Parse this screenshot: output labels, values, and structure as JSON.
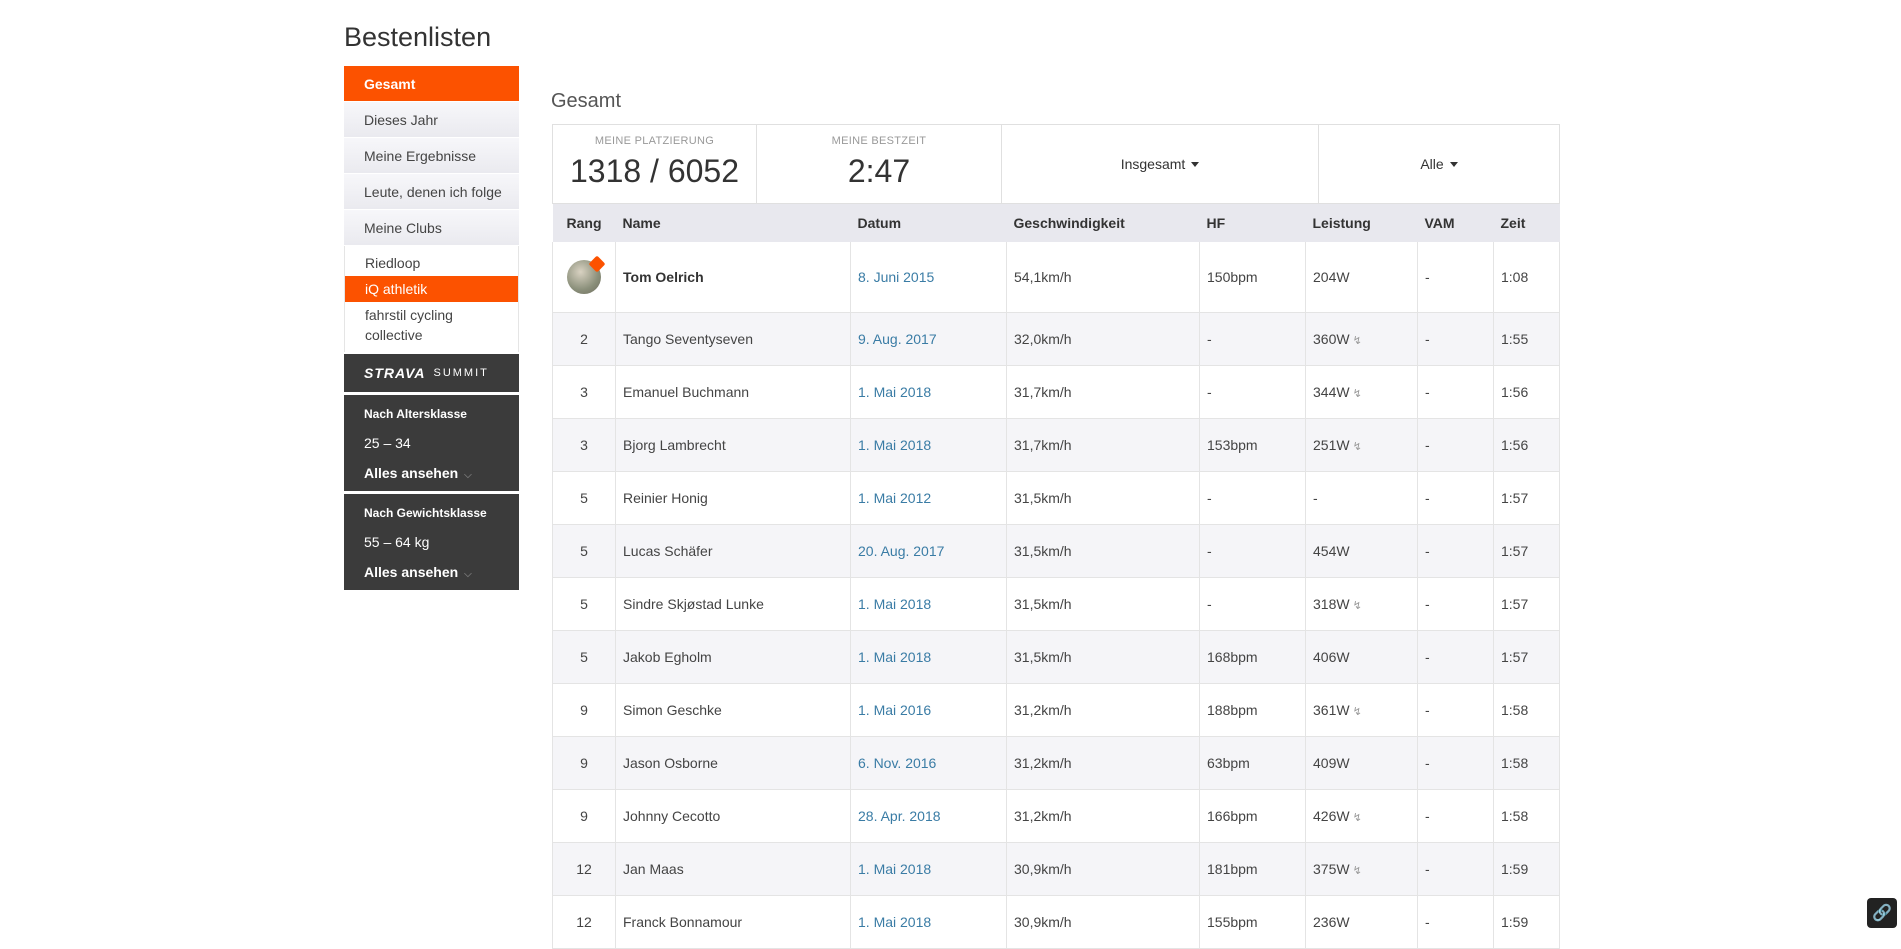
{
  "page_title": "Bestenlisten",
  "sidebar": {
    "items": [
      {
        "label": "Gesamt",
        "active": true
      },
      {
        "label": "Dieses Jahr",
        "active": false
      },
      {
        "label": "Meine Ergebnisse",
        "active": false
      },
      {
        "label": "Leute, denen ich folge",
        "active": false
      },
      {
        "label": "Meine Clubs",
        "active": false
      }
    ],
    "clubs": [
      {
        "label": "Riedloop",
        "active": false
      },
      {
        "label": "iQ athletik",
        "active": true
      },
      {
        "label": "fahrstil cycling collective",
        "active": false
      }
    ],
    "summit": {
      "logo": "STRAVA",
      "sub": "SUMMIT"
    },
    "age_filter": {
      "title": "Nach Altersklasse",
      "value": "25 – 34",
      "link": "Alles ansehen"
    },
    "weight_filter": {
      "title": "Nach Gewichtsklasse",
      "value": "55 – 64 kg",
      "link": "Alles ansehen"
    }
  },
  "main": {
    "section_title": "Gesamt",
    "stats": {
      "rank_label": "MEINE PLATZIERUNG",
      "rank_value": "1318 / 6052",
      "best_label": "MEINE BESTZEIT",
      "best_value": "2:47",
      "scope_dropdown": "Insgesamt",
      "filter_dropdown": "Alle"
    },
    "columns": [
      "Rang",
      "Name",
      "Datum",
      "Geschwindigkeit",
      "HF",
      "Leistung",
      "VAM",
      "Zeit"
    ],
    "rows": [
      {
        "rank": "",
        "name": "Tom Oelrich",
        "date": "8. Juni 2015",
        "speed": "54,1km/h",
        "hr": "150bpm",
        "power": "204W",
        "power_measured": false,
        "vam": "-",
        "time": "1:08",
        "me": true
      },
      {
        "rank": "2",
        "name": "Tango Seventyseven",
        "date": "9. Aug. 2017",
        "speed": "32,0km/h",
        "hr": "-",
        "power": "360W",
        "power_measured": true,
        "vam": "-",
        "time": "1:55"
      },
      {
        "rank": "3",
        "name": "Emanuel Buchmann",
        "date": "1. Mai 2018",
        "speed": "31,7km/h",
        "hr": "-",
        "power": "344W",
        "power_measured": true,
        "vam": "-",
        "time": "1:56"
      },
      {
        "rank": "3",
        "name": "Bjorg Lambrecht",
        "date": "1. Mai 2018",
        "speed": "31,7km/h",
        "hr": "153bpm",
        "power": "251W",
        "power_measured": true,
        "vam": "-",
        "time": "1:56"
      },
      {
        "rank": "5",
        "name": "Reinier Honig",
        "date": "1. Mai 2012",
        "speed": "31,5km/h",
        "hr": "-",
        "power": "-",
        "power_measured": false,
        "vam": "-",
        "time": "1:57"
      },
      {
        "rank": "5",
        "name": "Lucas Schäfer",
        "date": "20. Aug. 2017",
        "speed": "31,5km/h",
        "hr": "-",
        "power": "454W",
        "power_measured": false,
        "vam": "-",
        "time": "1:57"
      },
      {
        "rank": "5",
        "name": "Sindre Skjøstad Lunke",
        "date": "1. Mai 2018",
        "speed": "31,5km/h",
        "hr": "-",
        "power": "318W",
        "power_measured": true,
        "vam": "-",
        "time": "1:57"
      },
      {
        "rank": "5",
        "name": "Jakob Egholm",
        "date": "1. Mai 2018",
        "speed": "31,5km/h",
        "hr": "168bpm",
        "power": "406W",
        "power_measured": false,
        "vam": "-",
        "time": "1:57"
      },
      {
        "rank": "9",
        "name": "Simon Geschke",
        "date": "1. Mai 2016",
        "speed": "31,2km/h",
        "hr": "188bpm",
        "power": "361W",
        "power_measured": true,
        "vam": "-",
        "time": "1:58"
      },
      {
        "rank": "9",
        "name": "Jason Osborne",
        "date": "6. Nov. 2016",
        "speed": "31,2km/h",
        "hr": "63bpm",
        "power": "409W",
        "power_measured": false,
        "vam": "-",
        "time": "1:58"
      },
      {
        "rank": "9",
        "name": "Johnny Cecotto",
        "date": "28. Apr. 2018",
        "speed": "31,2km/h",
        "hr": "166bpm",
        "power": "426W",
        "power_measured": true,
        "vam": "-",
        "time": "1:58"
      },
      {
        "rank": "12",
        "name": "Jan Maas",
        "date": "1. Mai 2018",
        "speed": "30,9km/h",
        "hr": "181bpm",
        "power": "375W",
        "power_measured": true,
        "vam": "-",
        "time": "1:59"
      },
      {
        "rank": "12",
        "name": "Franck Bonnamour",
        "date": "1. Mai 2018",
        "speed": "30,9km/h",
        "hr": "155bpm",
        "power": "236W",
        "power_measured": false,
        "vam": "-",
        "time": "1:59"
      }
    ]
  },
  "colors": {
    "accent": "#fc5200",
    "dark_panel": "#3b3b3b",
    "link": "#3a7ca5"
  },
  "icons": {
    "power_meter": "lightning-icon",
    "corner": "link-icon"
  }
}
